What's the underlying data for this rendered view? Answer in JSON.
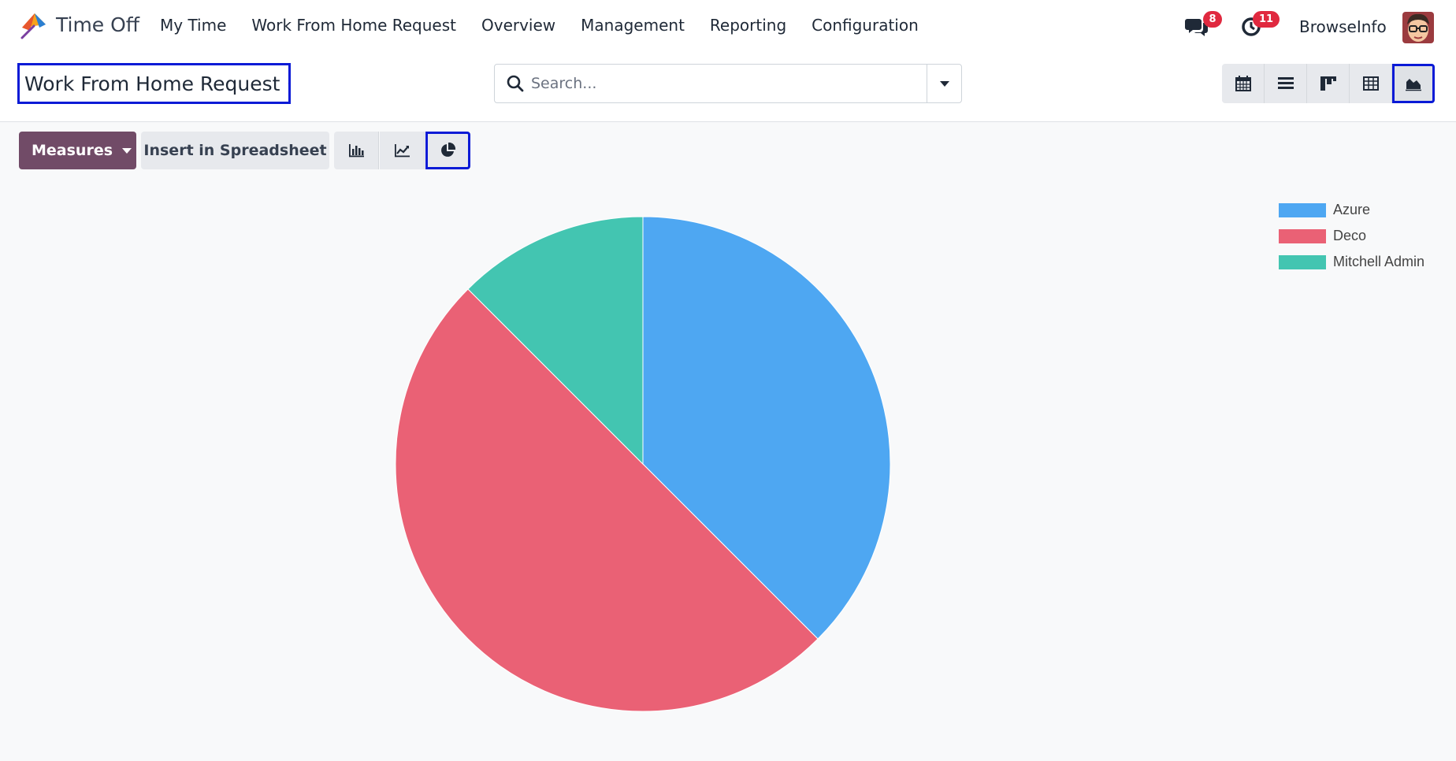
{
  "app": {
    "name": "Time Off",
    "logo_icon": "umbrella-icon"
  },
  "menu": [
    {
      "label": "My Time"
    },
    {
      "label": "Work From Home Request"
    },
    {
      "label": "Overview"
    },
    {
      "label": "Management"
    },
    {
      "label": "Reporting"
    },
    {
      "label": "Configuration"
    }
  ],
  "systray": {
    "messages_badge": "8",
    "activities_badge": "11",
    "company": "BrowseInfo"
  },
  "breadcrumb": {
    "title": "Work From Home Request"
  },
  "search": {
    "placeholder": "Search...",
    "value": ""
  },
  "views": [
    {
      "name": "calendar",
      "icon": "calendar-icon",
      "active": false
    },
    {
      "name": "list",
      "icon": "list-icon",
      "active": false
    },
    {
      "name": "kanban",
      "icon": "kanban-icon",
      "active": false
    },
    {
      "name": "pivot",
      "icon": "pivot-icon",
      "active": false
    },
    {
      "name": "graph",
      "icon": "area-chart-icon",
      "active": true
    }
  ],
  "toolbar": {
    "measures_label": "Measures",
    "insert_label": "Insert in Spreadsheet",
    "graph_types": [
      {
        "name": "bar",
        "icon": "bar-chart-icon",
        "active": false
      },
      {
        "name": "line",
        "icon": "line-chart-icon",
        "active": false
      },
      {
        "name": "pie",
        "icon": "pie-chart-icon",
        "active": true
      }
    ]
  },
  "chart_data": {
    "type": "pie",
    "categories": [
      "Azure",
      "Deco",
      "Mitchell Admin"
    ],
    "values": [
      3,
      4,
      1
    ],
    "colors": [
      "#4ea7f2",
      "#ea6175",
      "#43c5b1"
    ],
    "legend": "top-right"
  }
}
